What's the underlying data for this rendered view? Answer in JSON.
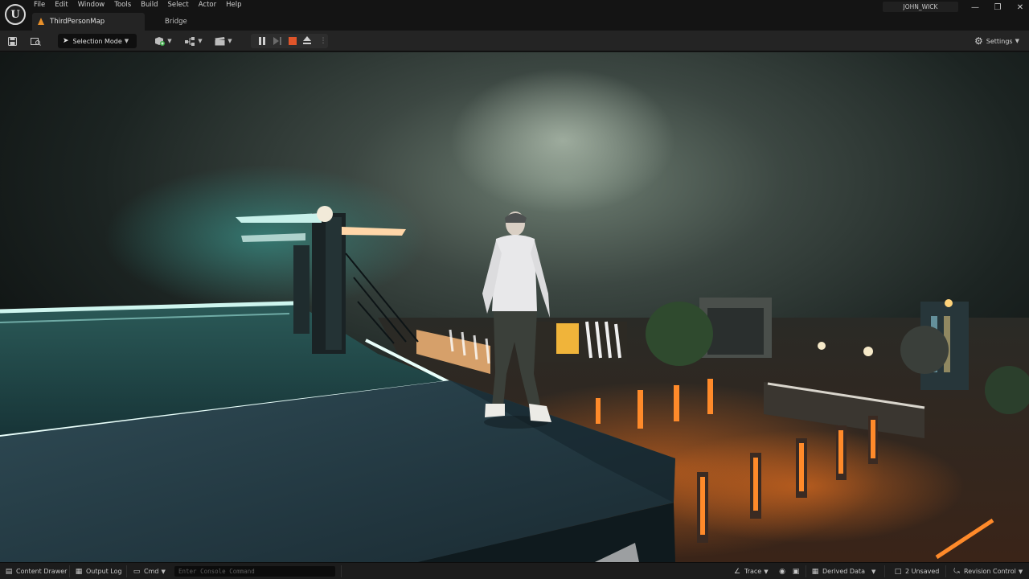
{
  "menu": [
    "File",
    "Edit",
    "Window",
    "Tools",
    "Build",
    "Select",
    "Actor",
    "Help"
  ],
  "tabs": {
    "active": "ThirdPersonMap",
    "inactive": "Bridge"
  },
  "user": "JOHN_WICK",
  "toolbar": {
    "mode_label": "Selection Mode",
    "settings_label": "Settings"
  },
  "statusbar": {
    "content_drawer": "Content Drawer",
    "output_log": "Output Log",
    "cmd": "Cmd",
    "console_placeholder": "Enter Console Command",
    "trace": "Trace",
    "derived_data": "Derived Data",
    "unsaved": "2 Unsaved",
    "revision_control": "Revision Control"
  },
  "colors": {
    "accent_orange": "#e8902a",
    "stop_red": "#e0552a",
    "neon_teal": "#bff4ec",
    "bollard_orange": "#ff8a2a"
  }
}
